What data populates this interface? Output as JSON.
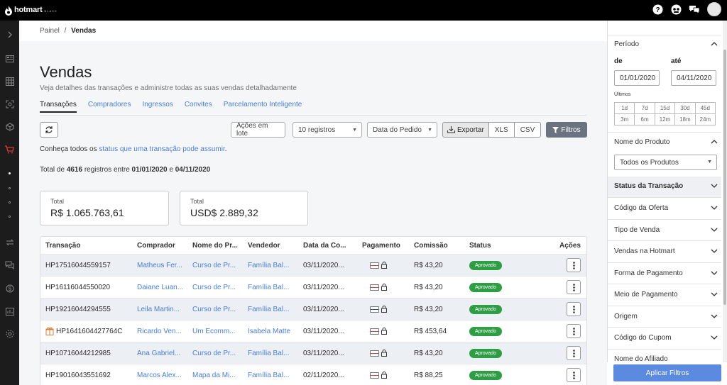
{
  "app": {
    "name": "hotmart",
    "sub": "BLACK"
  },
  "breadcrumb": {
    "root": "Painel",
    "sep": "/",
    "current": "Vendas"
  },
  "page": {
    "title": "Vendas",
    "subtitle": "Veja detalhes das transações e administre todas as suas vendas detalhadamente"
  },
  "tabs": [
    {
      "label": "Transações",
      "active": true
    },
    {
      "label": "Compradores"
    },
    {
      "label": "Ingressos"
    },
    {
      "label": "Convites"
    },
    {
      "label": "Parcelamento Inteligente"
    }
  ],
  "toolbar": {
    "batch": "Ações em lote",
    "records": "10 registros",
    "date": "Data do Pedido",
    "export": "Exportar",
    "xls": "XLS",
    "csv": "CSV",
    "filters": "Filtros"
  },
  "info": {
    "pre": "Conheça todos os ",
    "link": "status que uma transação pode assumir",
    "post": "."
  },
  "total": {
    "pre": "Total de ",
    "count": "4616",
    "mid": " registros entre ",
    "from": "01/01/2020",
    "and": " e ",
    "to": "04/11/2020"
  },
  "cards": [
    {
      "label": "Total",
      "value": "R$ 1.065.763,61"
    },
    {
      "label": "Total",
      "value": "USD$ 2.889,32"
    }
  ],
  "table": {
    "headers": [
      "Transação",
      "Comprador",
      "Nome do Pr...",
      "Vendedor",
      "Data da Co...",
      "Pagamento",
      "Comissão",
      "Status",
      "Ações"
    ],
    "rows": [
      {
        "id": "HP17516044559157",
        "buyer": "Matheus Fer...",
        "product": "Curso de Pr...",
        "seller": "Família Bal...",
        "date": "03/11/2020...",
        "commission": "R$ 43,20",
        "status": "Aprovado"
      },
      {
        "id": "HP16116044550020",
        "buyer": "Daiane Luan...",
        "product": "Curso de Pr...",
        "seller": "Família Bal...",
        "date": "03/11/2020...",
        "commission": "R$ 43,20",
        "status": "Aprovado"
      },
      {
        "id": "HP19216044294555",
        "buyer": "Leila Martin...",
        "product": "Curso de Pr...",
        "seller": "Família Bal...",
        "date": "03/11/2020...",
        "commission": "R$ 43,20",
        "status": "Aprovado"
      },
      {
        "id": "HP1641604427764C",
        "buyer": "Ricardo Ven...",
        "product": "Um Ecomm...",
        "seller": "Isabela Matte",
        "date": "03/11/2020...",
        "commission": "R$ 453,64",
        "status": "Aprovado"
      },
      {
        "id": "HP10716044212985",
        "buyer": "Ana Gabriel...",
        "product": "Curso de Pr...",
        "seller": "Família Bal...",
        "date": "03/11/2020...",
        "commission": "R$ 43,20",
        "status": "Aprovado"
      },
      {
        "id": "HP19016043551692",
        "buyer": "Marcos Alex...",
        "product": "Mapa da Mi...",
        "seller": "Família Bal...",
        "date": "02/11/2020...",
        "commission": "R$ 88,25",
        "status": "Aprovado"
      }
    ]
  },
  "filters": {
    "period": {
      "title": "Período",
      "from_label": "de",
      "to_label": "até",
      "from": "01/01/2020",
      "to": "04/11/2020",
      "last": "Últimos",
      "options": [
        "1d",
        "7d",
        "15d",
        "30d",
        "45d",
        "3m",
        "6m",
        "12m",
        "18m",
        "24m"
      ]
    },
    "product": {
      "title": "Nome do Produto",
      "value": "Todos os Produtos"
    },
    "sections": [
      "Status da Transação",
      "Código da Oferta",
      "Tipo de Venda",
      "Vendas na Hotmart",
      "Forma de Pagamento",
      "Meio de Pagamento",
      "Origem",
      "Código do Cupom",
      "Nome do Afiliado"
    ],
    "apply": "Aplicar Filtros"
  },
  "colors": {
    "accent": "#4a7fd4",
    "approved": "#2e9e44",
    "apply": "#5a8be0",
    "active_nav": "#e03a2f"
  }
}
